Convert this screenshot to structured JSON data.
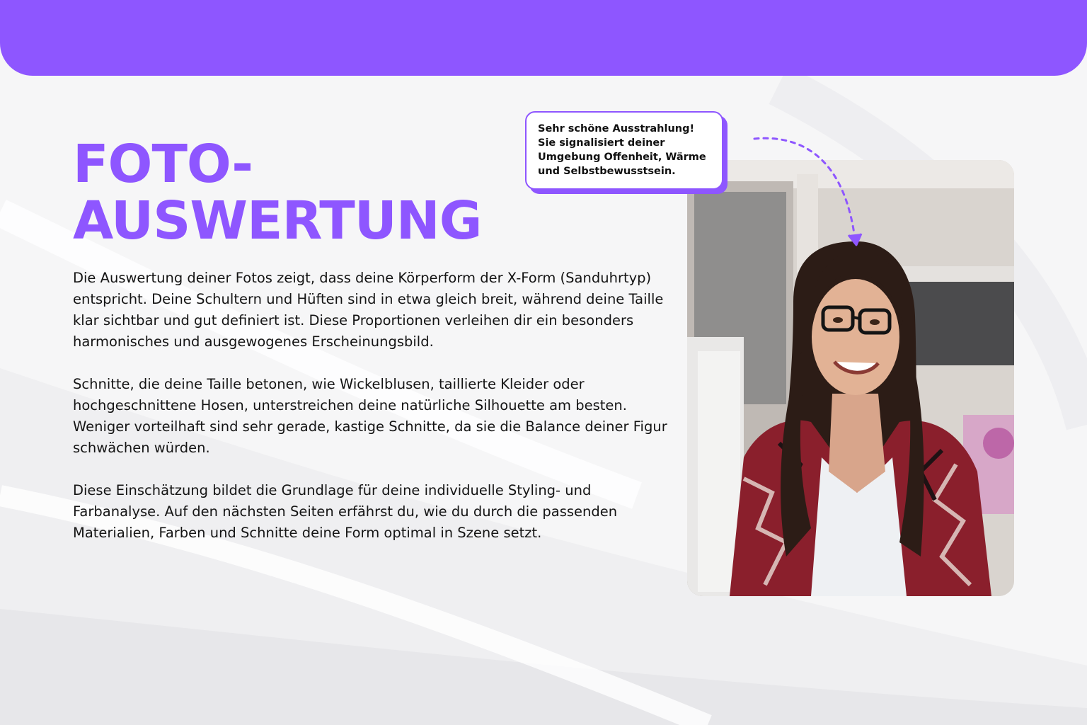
{
  "title": {
    "line1": "FOTO-",
    "line2": "AUSWERTUNG"
  },
  "paragraphs": [
    "Die Auswertung deiner Fotos zeigt, dass deine Körperform der X-Form (Sanduhrtyp) entspricht. Deine Schultern und Hüften sind in etwa gleich breit, während deine Taille klar sichtbar und gut definiert ist. Diese Proportionen verleihen dir ein besonders harmonisches und ausgewogenes Erscheinungsbild.",
    "Schnitte, die deine Taille betonen, wie Wickelblusen, taillierte Kleider oder hochgeschnittene Hosen, unterstreichen deine natürliche Silhouette am besten. Weniger vorteilhaft sind sehr gerade, kastige Schnitte, da sie die Balance deiner Figur schwächen würden.",
    "Diese Einschätzung bildet die Grundlage für deine individuelle Styling- und Farbanalyse. Auf den nächsten Seiten erfährst du, wie du durch die passenden Materialien, Farben und Schnitte deine Form optimal in Szene setzt."
  ],
  "callout": {
    "text": "Sehr schöne Ausstrahlung! Sie signalisiert deiner Umgebung Offenheit, Wärme und Selbstbewusstsein."
  },
  "photo": {
    "subject": "portrait-photo"
  },
  "colors": {
    "accent": "#8e56ff",
    "text": "#141414",
    "background": "#f7f7f8"
  }
}
